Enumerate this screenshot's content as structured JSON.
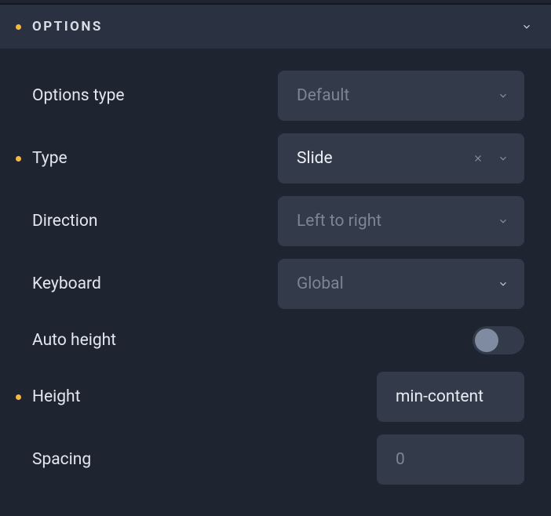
{
  "section": {
    "title": "OPTIONS"
  },
  "rows": {
    "options_type": {
      "label": "Options type",
      "value": "Default"
    },
    "type": {
      "label": "Type",
      "value": "Slide"
    },
    "direction": {
      "label": "Direction",
      "value": "Left to right"
    },
    "keyboard": {
      "label": "Keyboard",
      "value": "Global"
    },
    "auto_height": {
      "label": "Auto height",
      "value": false
    },
    "height": {
      "label": "Height",
      "value": "min-content"
    },
    "spacing": {
      "label": "Spacing",
      "value": "",
      "placeholder": "0"
    }
  }
}
